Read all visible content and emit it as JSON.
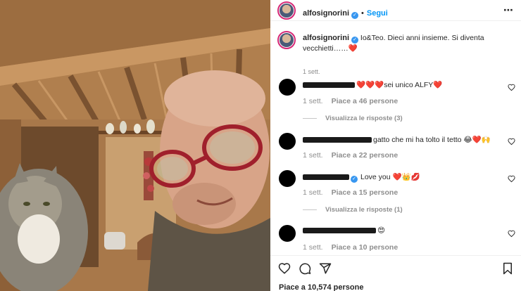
{
  "post": {
    "username": "alfosignorini",
    "follow_label": "Segui",
    "more_icon": "more-icon",
    "caption": "Io&Teo. Dieci anni insieme. Si diventa vecchietti……❤️",
    "caption_time": "1 sett.",
    "likes_text": "Piace a 10,574 persone"
  },
  "comments": [
    {
      "text": "❤️❤️❤️sei unico ALFY❤️",
      "time": "1 sett.",
      "likes": "Piace a 46 persone",
      "replies": "Visualizza le risposte (3)"
    },
    {
      "text": "gatto che mi ha tolto il tetto 😂❤️🙌",
      "time": "1 sett.",
      "likes": "Piace a 22 persone",
      "replies": ""
    },
    {
      "text": "Love you ❤️👑💋",
      "time": "1 sett.",
      "likes": "Piace a 15 persone",
      "replies": "Visualizza le risposte (1)"
    },
    {
      "text": "😍",
      "time": "1 sett.",
      "likes": "Piace a 10 persone",
      "replies": ""
    }
  ],
  "icons": {
    "verified": "verified-badge-icon",
    "heart": "heart-icon",
    "comment": "comment-icon",
    "share": "share-icon",
    "save": "bookmark-icon"
  },
  "colors": {
    "accent": "#0095f6",
    "verified": "#3897f0",
    "muted": "#8e8e8e",
    "text": "#262626"
  }
}
